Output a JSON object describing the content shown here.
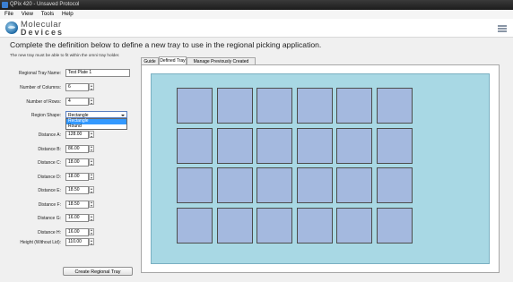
{
  "window": {
    "title": "QPix 420 - Unsaved Protocol"
  },
  "menu": [
    "File",
    "View",
    "Tools",
    "Help"
  ],
  "brand": {
    "line1": "Molecular",
    "line2": "Devices"
  },
  "heading": "Complete the definition below to define a new tray to use in the regional picking application.",
  "note": "The new tray must be able to fit within the omni tray holder.",
  "form": {
    "tray_name": {
      "label": "Regional Tray Name:",
      "value": "Test Plate 1"
    },
    "columns": {
      "label": "Number of Columns:",
      "value": "6"
    },
    "rows": {
      "label": "Number of Rows:",
      "value": "4"
    },
    "shape": {
      "label": "Region Shape:",
      "value": "Rectangle",
      "options": [
        "Rectangle",
        "Round"
      ]
    },
    "distances": [
      {
        "label": "Distance A:",
        "value": "128.00"
      },
      {
        "label": "Distance B:",
        "value": "86.00"
      },
      {
        "label": "Distance C:",
        "value": "18.00"
      },
      {
        "label": "Distance D:",
        "value": "18.00"
      },
      {
        "label": "Distance E:",
        "value": "18.50"
      },
      {
        "label": "Distance F:",
        "value": "18.50"
      },
      {
        "label": "Distance G:",
        "value": "16.00"
      },
      {
        "label": "Distance H:",
        "value": "16.00"
      }
    ],
    "height": {
      "label": "Height (Without Lid):",
      "value": "110.00"
    },
    "create_button": "Create Regional Tray"
  },
  "tabs": [
    {
      "label": "Guide",
      "active": false
    },
    {
      "label": "Defined Tray",
      "active": true
    },
    {
      "label": "Manage Previously Created Trays",
      "active": false
    }
  ],
  "tray_preview": {
    "columns": 6,
    "rows": 4,
    "well_color": "#a4b9df",
    "tray_color": "#a8d8e4"
  }
}
